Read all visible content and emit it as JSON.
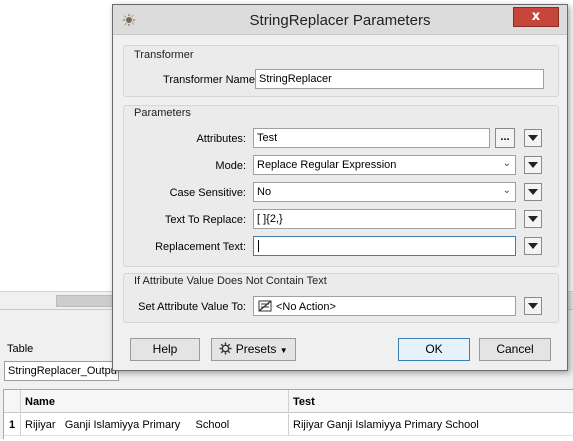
{
  "dialog": {
    "title": "StringReplacer Parameters",
    "close_label": "x"
  },
  "transformer_group": {
    "title": "Transformer",
    "name_label": "Transformer Name:",
    "name_value": "StringReplacer"
  },
  "parameters_group": {
    "title": "Parameters",
    "attributes_label": "Attributes:",
    "attributes_value": "Test",
    "attributes_browse": "...",
    "mode_label": "Mode:",
    "mode_value": "Replace Regular Expression",
    "case_label": "Case Sensitive:",
    "case_value": "No",
    "text_to_replace_label": "Text To Replace:",
    "text_to_replace_value": "[ ]{2,}",
    "replacement_label": "Replacement Text:",
    "replacement_value": ""
  },
  "no_text_group": {
    "title": "If Attribute Value Does Not Contain Text",
    "set_label": "Set Attribute Value To:",
    "set_value": "<No Action>"
  },
  "buttons": {
    "help": "Help",
    "presets": "Presets",
    "ok": "OK",
    "cancel": "Cancel"
  },
  "background": {
    "table_label": "Table",
    "dataset": "StringReplacer_Outpu",
    "columns": [
      "Name",
      "Test"
    ],
    "row_number": "1",
    "row_name": "Rijiyar   Ganji Islamiyya Primary     School",
    "row_test": "Rijiyar Ganji Islamiyya Primary School"
  },
  "colors": {
    "close_button": "#c7463b",
    "ok_border": "#3c7fb1"
  }
}
